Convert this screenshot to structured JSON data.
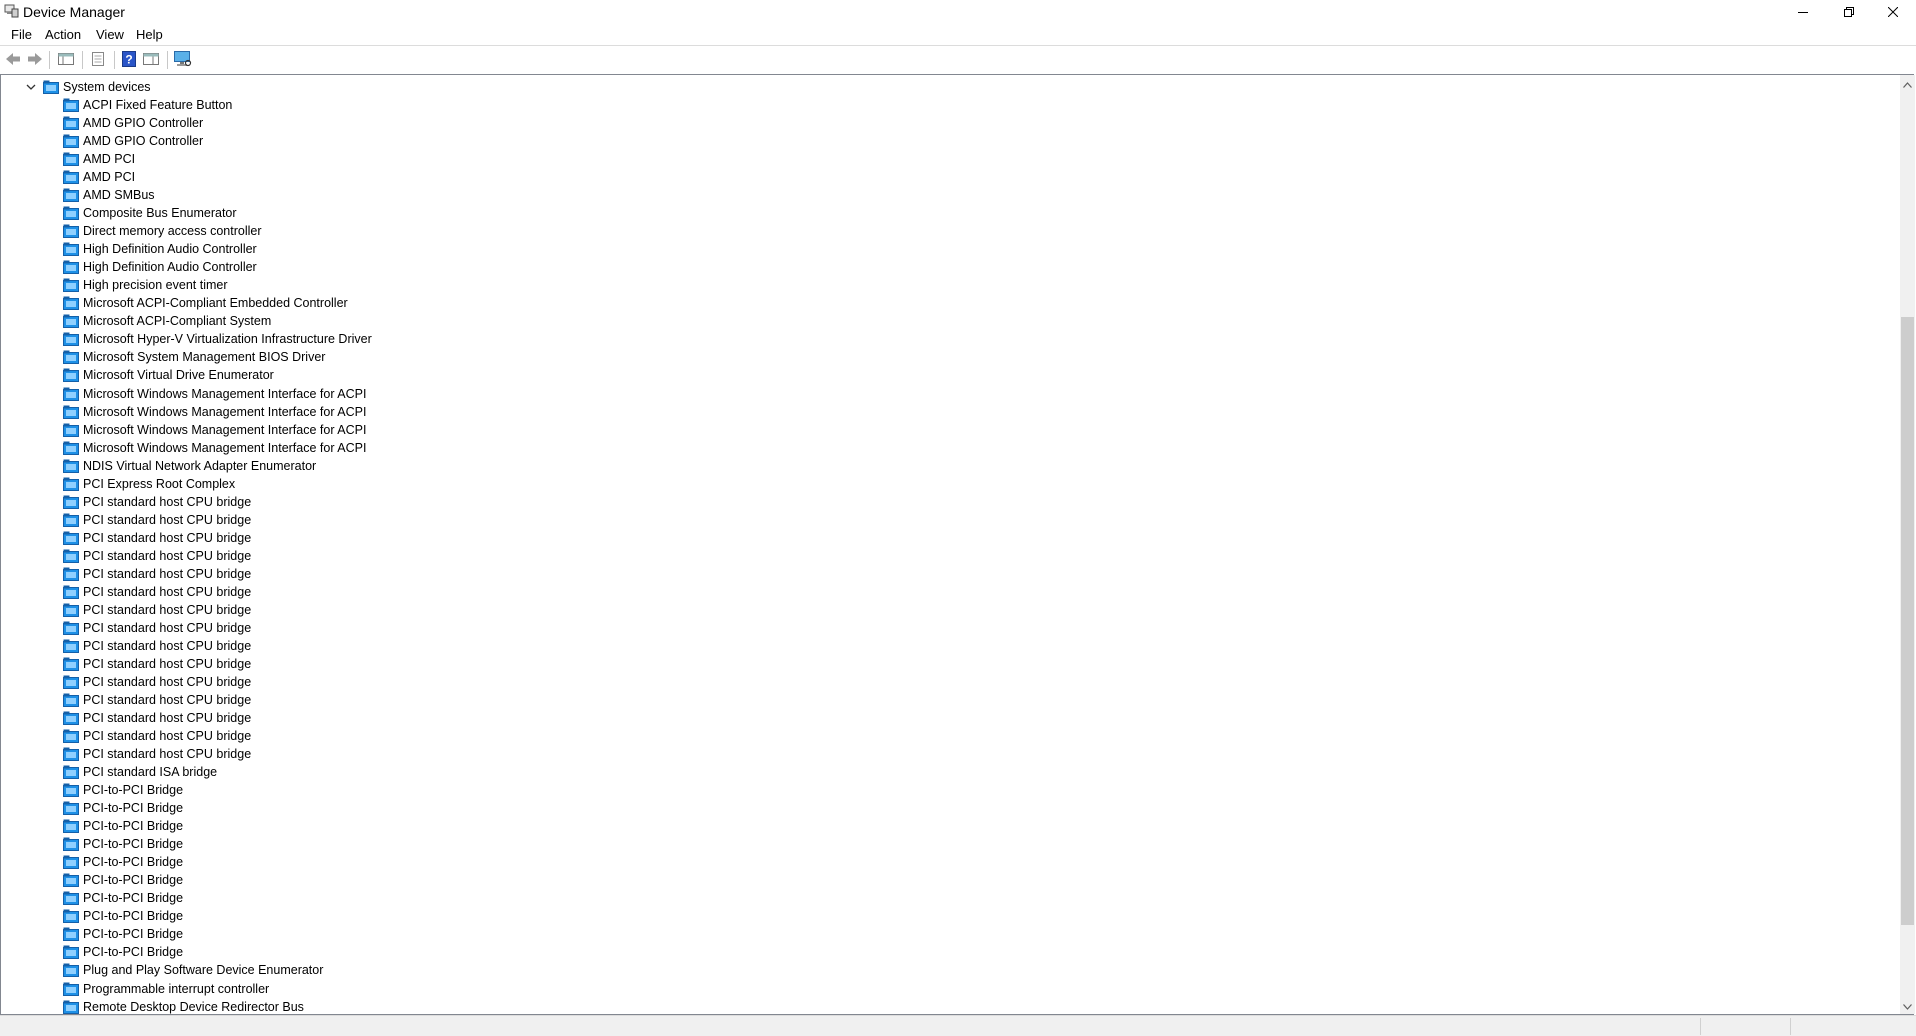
{
  "window": {
    "title": "Device Manager",
    "controls": {
      "minimize": "minimize-icon",
      "restore": "restore-icon",
      "close": "close-icon"
    }
  },
  "menubar": {
    "items": [
      "File",
      "Action",
      "View",
      "Help"
    ]
  },
  "toolbar": {
    "buttons": [
      "back-icon",
      "forward-icon",
      "show-hide-console-tree-icon",
      "properties-icon",
      "help-icon",
      "action-pane-icon",
      "scan-hardware-icon"
    ]
  },
  "tree": {
    "category": "System devices",
    "category_expanded": true,
    "items": [
      "ACPI Fixed Feature Button",
      "AMD GPIO Controller",
      "AMD GPIO Controller",
      "AMD PCI",
      "AMD PCI",
      "AMD SMBus",
      "Composite Bus Enumerator",
      "Direct memory access controller",
      "High Definition Audio Controller",
      "High Definition Audio Controller",
      "High precision event timer",
      "Microsoft ACPI-Compliant Embedded Controller",
      "Microsoft ACPI-Compliant System",
      "Microsoft Hyper-V Virtualization Infrastructure Driver",
      "Microsoft System Management BIOS Driver",
      "Microsoft Virtual Drive Enumerator",
      "Microsoft Windows Management Interface for ACPI",
      "Microsoft Windows Management Interface for ACPI",
      "Microsoft Windows Management Interface for ACPI",
      "Microsoft Windows Management Interface for ACPI",
      "NDIS Virtual Network Adapter Enumerator",
      "PCI Express Root Complex",
      "PCI standard host CPU bridge",
      "PCI standard host CPU bridge",
      "PCI standard host CPU bridge",
      "PCI standard host CPU bridge",
      "PCI standard host CPU bridge",
      "PCI standard host CPU bridge",
      "PCI standard host CPU bridge",
      "PCI standard host CPU bridge",
      "PCI standard host CPU bridge",
      "PCI standard host CPU bridge",
      "PCI standard host CPU bridge",
      "PCI standard host CPU bridge",
      "PCI standard host CPU bridge",
      "PCI standard host CPU bridge",
      "PCI standard host CPU bridge",
      "PCI standard ISA bridge",
      "PCI-to-PCI Bridge",
      "PCI-to-PCI Bridge",
      "PCI-to-PCI Bridge",
      "PCI-to-PCI Bridge",
      "PCI-to-PCI Bridge",
      "PCI-to-PCI Bridge",
      "PCI-to-PCI Bridge",
      "PCI-to-PCI Bridge",
      "PCI-to-PCI Bridge",
      "PCI-to-PCI Bridge",
      "Plug and Play Software Device Enumerator",
      "Programmable interrupt controller",
      "Remote Desktop Device Redirector Bus"
    ]
  },
  "colors": {
    "folder_blue": "#1e90e6",
    "folder_dark": "#1560a8",
    "border": "#828790"
  }
}
